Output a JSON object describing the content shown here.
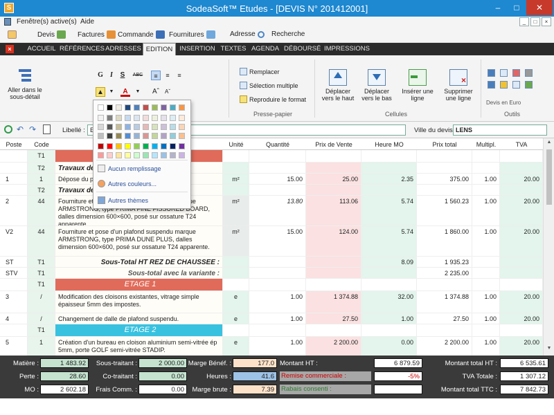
{
  "window": {
    "title": "SodeaSoft™ Etudes - [DEVIS N° 201412001]"
  },
  "menu": {
    "items": [
      "Fenêtre(s) active(s)",
      "Aide"
    ]
  },
  "toolbar": {
    "items": [
      "Devis",
      "Factures",
      "Commande",
      "Fournitures",
      "Adresse",
      "Recherche"
    ]
  },
  "tabs": [
    "ACCUEIL",
    "RÉFÉRENCES",
    "ADRESSES",
    "EDITION",
    "INSERTION",
    "TEXTES",
    "AGENDA",
    "DÉBOURSÉ",
    "IMPRESSIONS"
  ],
  "active_tab": "EDITION",
  "ribbon": {
    "aller": "Aller dans le sous-détail",
    "bold": "G",
    "italic": "I",
    "strike": "S",
    "abc": "ABC",
    "remplacer": "Remplacer",
    "selection": "Sélection multiple",
    "reproduire": "Reproduire le format",
    "presse_papier": "Presse-papier",
    "deplacer_haut": "Déplacer vers le haut",
    "deplacer_bas": "Déplacer vers le bas",
    "inserer_ligne": "Insérer une ligne",
    "supprimer_ligne": "Supprimer une ligne",
    "cellules": "Cellules",
    "devis_euro": "Devis en Euro",
    "outils": "Outils"
  },
  "filter": {
    "libelle_label": "Libellé :",
    "libelle_value": "E",
    "ville_label": "Ville du devis :",
    "ville_value": "LENS"
  },
  "columns": [
    "Poste",
    "Code",
    "",
    "Unité",
    "Quantité",
    "Prix de Vente",
    "Heure MO",
    "Prix total",
    "Multipl.",
    "TVA"
  ],
  "rows": [
    {
      "poste": "",
      "code": "T1",
      "text": "",
      "unite": "",
      "qte": "",
      "pv": "",
      "hmo": "",
      "pt": "",
      "mult": "",
      "tva": "",
      "type": "band-red"
    },
    {
      "poste": "",
      "code": "T2",
      "text": "Travaux de",
      "unite": "",
      "qte": "",
      "pv": "",
      "hmo": "",
      "pt": "",
      "mult": "",
      "tva": "",
      "type": "title"
    },
    {
      "poste": "1",
      "code": "1",
      "text": "Dépose du plafond existant et évacuation.",
      "unite": "m²",
      "qte": "15.00",
      "pv": "25.00",
      "hmo": "2.35",
      "pt": "375.00",
      "mult": "1.00",
      "tva": "20.00",
      "type": "item"
    },
    {
      "poste": "",
      "code": "T2",
      "text": "Travaux de",
      "unite": "",
      "qte": "",
      "pv": "",
      "hmo": "",
      "pt": "",
      "mult": "",
      "tva": "",
      "type": "title"
    },
    {
      "poste": "2",
      "code": "44",
      "text": "Fourniture et pose d'un plafond suspendu marque ARMSTRONG, type PRIMA FINE FISSURED BOARD, dalles dimension 600×600, posé sur ossature T24 apparente.",
      "unite": "m²",
      "qte": "13.80",
      "pv": "113.06",
      "hmo": "5.74",
      "pt": "1 560.23",
      "mult": "1.00",
      "tva": "20.00",
      "type": "item3"
    },
    {
      "poste": "V2",
      "code": "44",
      "text": "Fourniture et pose d'un plafond suspendu marque ARMSTRONG, type PRIMA DUNE PLUS, dalles dimension 600×600, posé sur ossature T24 apparente.",
      "unite": "m²",
      "qte": "15.00",
      "pv": "124.00",
      "hmo": "5.74",
      "pt": "1 860.00",
      "mult": "1.00",
      "tva": "20.00",
      "type": "item3"
    },
    {
      "poste": "ST",
      "code": "T1",
      "text": "Sous-Total HT REZ DE CHAUSSEE :",
      "unite": "",
      "qte": "",
      "pv": "",
      "hmo": "8.09",
      "pt": "1 935.23",
      "mult": "",
      "tva": "",
      "type": "subtotal"
    },
    {
      "poste": "STV",
      "code": "T1",
      "text": "Sous-total avec la variante :",
      "unite": "",
      "qte": "",
      "pv": "",
      "hmo": "",
      "pt": "2 235.00",
      "mult": "",
      "tva": "",
      "type": "subtotal2"
    },
    {
      "poste": "",
      "code": "T1",
      "text": "ETAGE 1",
      "unite": "",
      "qte": "",
      "pv": "",
      "hmo": "",
      "pt": "",
      "mult": "",
      "tva": "",
      "type": "band-red"
    },
    {
      "poste": "3",
      "code": "/",
      "text": "Modification des cloisons existantes, vitrage simple épaisseur 5mm des impostes.",
      "unite": "e",
      "qte": "1.00",
      "pv": "1 374.88",
      "hmo": "32.00",
      "pt": "1 374.88",
      "mult": "1.00",
      "tva": "20.00",
      "type": "item2"
    },
    {
      "poste": "4",
      "code": "/",
      "text": "Changement de dalle de plafond suspendu.",
      "unite": "e",
      "qte": "1.00",
      "pv": "27.50",
      "hmo": "1.00",
      "pt": "27.50",
      "mult": "1.00",
      "tva": "20.00",
      "type": "item"
    },
    {
      "poste": "",
      "code": "T1",
      "text": "ETAGE 2",
      "unite": "",
      "qte": "",
      "pv": "",
      "hmo": "",
      "pt": "",
      "mult": "",
      "tva": "",
      "type": "band-cyan"
    },
    {
      "poste": "5",
      "code": "1",
      "text": "Création d'un bureau en cloison aluminium semi-vitrée ép 5mm, porte GOLF semi-vitrée STADIP.",
      "unite": "e",
      "qte": "1.00",
      "pv": "2 200.00",
      "hmo": "0.00",
      "pt": "2 200.00",
      "mult": "1.00",
      "tva": "20.00",
      "type": "item2"
    }
  ],
  "footer": {
    "materiel_label": "Matière :",
    "materiel": "1 483.92",
    "perte_label": "Perte :",
    "perte": "28.60",
    "mo_label": "MO :",
    "mo": "2 602.18",
    "sous_traitant_label": "Sous-traitant :",
    "sous_traitant": "2 000.00",
    "co_traitant_label": "Co-traitant :",
    "co_traitant": "0.00",
    "frais_label": "Frais Comm. :",
    "frais": "0.00",
    "marge_benef_label": "Marge Bénéf. :",
    "marge_benef": "177.0",
    "heures_label": "Heures :",
    "heures": "41.6",
    "marge_brute_label": "Marge brute :",
    "marge_brute": "7.39",
    "montant_ht_label": "Montant HT :",
    "montant_ht": "6 879.59",
    "remise_label": "Remise commerciale :",
    "remise": "-5%",
    "rabais_label": "Rabais consenti :",
    "rabais": "",
    "total_ht_label": "Montant total HT :",
    "total_ht": "6 535.61",
    "tva_label": "TVA Totale :",
    "tva": "1 307.12",
    "ttc_label": "Montant total TTC :",
    "ttc": "7 842.73"
  },
  "popup": {
    "no_fill": "Aucun remplissage",
    "more_colors": "Autres couleurs...",
    "themes": "Autres thèmes",
    "palette": [
      [
        "#ffffff",
        "#000000",
        "#eeece1",
        "#1f497d",
        "#4f81bd",
        "#c0504d",
        "#9bbb59",
        "#8064a2",
        "#4bacc6",
        "#f79646"
      ],
      [
        "#f2f2f2",
        "#7f7f7f",
        "#ddd9c3",
        "#c6d9f0",
        "#dbe5f1",
        "#f2dcdb",
        "#ebf1dd",
        "#e5e0ec",
        "#dbeef3",
        "#fdeada"
      ],
      [
        "#d8d8d8",
        "#595959",
        "#c4bd97",
        "#8db3e2",
        "#b8cce4",
        "#e5b9b7",
        "#d7e3bc",
        "#ccc1d9",
        "#b7dde8",
        "#fbd5b5"
      ],
      [
        "#bfbfbf",
        "#3f3f3f",
        "#938953",
        "#548dd4",
        "#95b3d7",
        "#d99694",
        "#c3d69b",
        "#b2a2c7",
        "#92cddc",
        "#fac08f"
      ],
      [
        "#c00000",
        "#ff0000",
        "#ffc000",
        "#ffff00",
        "#92d050",
        "#00b050",
        "#00b0f0",
        "#0070c0",
        "#002060",
        "#7030a0"
      ],
      [
        "#ff9999",
        "#ffcccc",
        "#ffe599",
        "#ffff99",
        "#ccffcc",
        "#99e6b3",
        "#b3e6ff",
        "#99c2e6",
        "#b3b3cc",
        "#ccb3e6"
      ]
    ]
  }
}
